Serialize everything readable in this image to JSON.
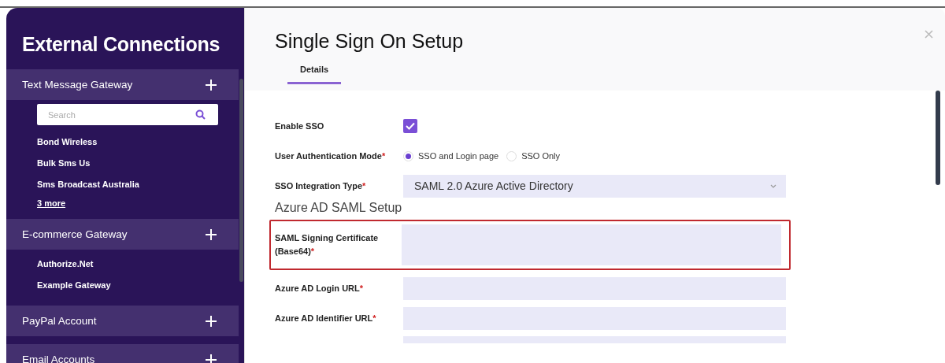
{
  "sidebar": {
    "title": "External Connections",
    "sections": [
      {
        "label": "Text Message Gateway",
        "search": {
          "placeholder": "Search"
        },
        "items": [
          "Bond Wireless",
          "Bulk Sms Us",
          "Sms Broadcast Australia"
        ],
        "more_link": "3 more"
      },
      {
        "label": "E-commerce Gateway",
        "items": [
          "Authorize.Net",
          "Example Gateway"
        ]
      },
      {
        "label": "PayPal Account"
      },
      {
        "label": "Email Accounts"
      }
    ]
  },
  "dialog": {
    "title": "Single Sign On Setup",
    "tabs": [
      {
        "label": "Details",
        "selected": true
      }
    ],
    "fields": [
      {
        "kind": "checkbox",
        "label": "Enable SSO",
        "checked": true
      },
      {
        "kind": "radio",
        "label": "User Authentication Mode",
        "required_mark": "*",
        "options": [
          {
            "label": "SSO and Login page",
            "selected": true
          },
          {
            "label": "SSO Only",
            "selected": false
          }
        ]
      },
      {
        "kind": "select",
        "label": "SSO Integration Type",
        "required_mark": "*",
        "value": "SAML 2.0 Azure Active Directory"
      },
      {
        "kind": "heading",
        "label": "Azure AD SAML Setup"
      },
      {
        "kind": "textarea",
        "label": "SAML Signing Certificate (Base64)",
        "required_mark": "*",
        "highlighted": true
      },
      {
        "kind": "text",
        "label": "Azure AD Login URL",
        "required_mark": "*"
      },
      {
        "kind": "text",
        "label": "Azure AD Identifier URL",
        "required_mark": "*"
      },
      {
        "kind": "partial"
      }
    ]
  }
}
